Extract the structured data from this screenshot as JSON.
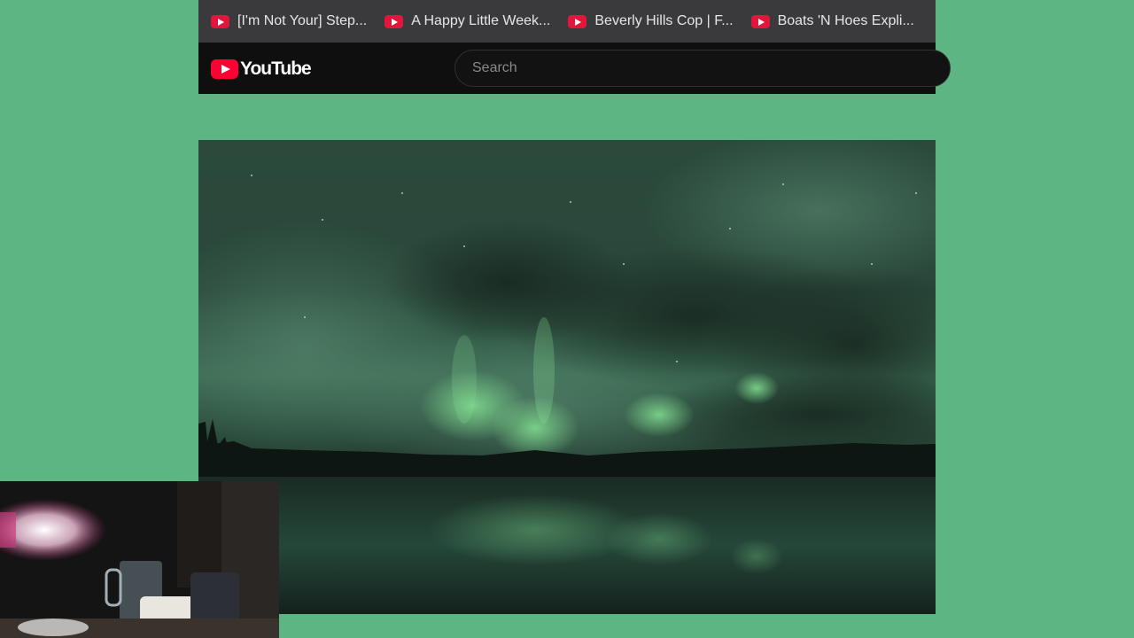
{
  "bookmarks": [
    {
      "label": "[I'm Not Your] Step...",
      "icon": "youtube-favicon-icon"
    },
    {
      "label": "A Happy Little Week...",
      "icon": "youtube-favicon-icon"
    },
    {
      "label": "Beverly Hills Cop | F...",
      "icon": "youtube-favicon-icon"
    },
    {
      "label": "Boats 'N Hoes Expli...",
      "icon": "youtube-favicon-icon"
    }
  ],
  "header": {
    "logo_text": "YouTube",
    "search_placeholder": "Search"
  },
  "video": {
    "content": "aurora-borealis-over-lake"
  },
  "webcam": {
    "content": "streamer-webcam-desk"
  },
  "colors": {
    "background": "#5db583",
    "bookmarks_bar": "#3a3a3d",
    "header": "#0f0f0f",
    "youtube_red": "#ff0033"
  }
}
